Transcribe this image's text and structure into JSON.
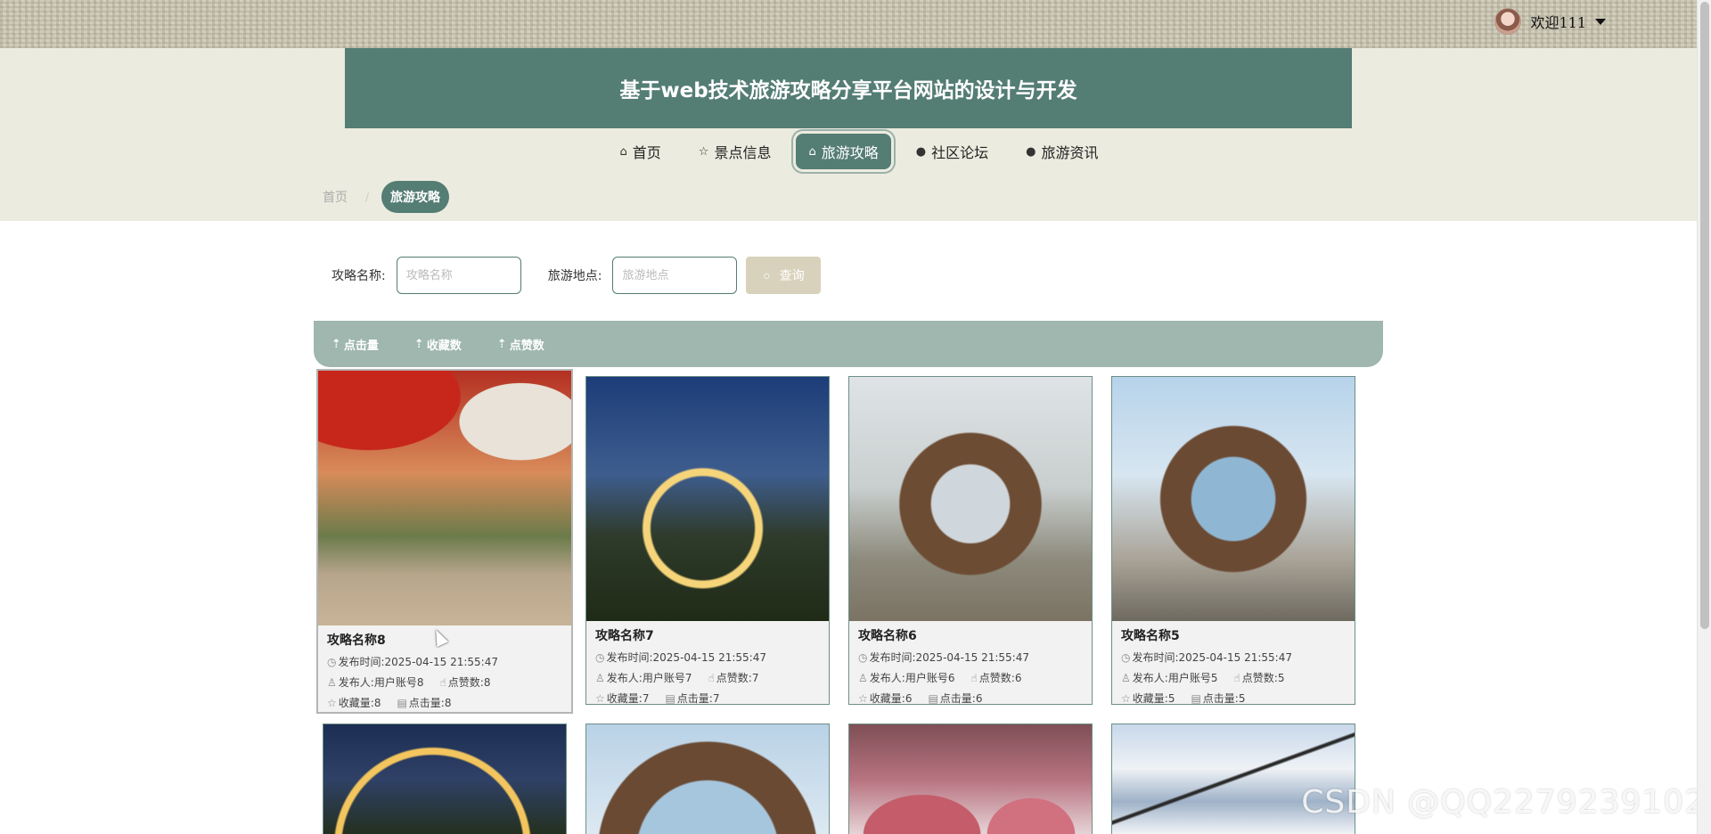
{
  "user": {
    "welcome": "欢迎111"
  },
  "banner": {
    "title": "基于web技术旅游攻略分享平台网站的设计与开发"
  },
  "nav": [
    {
      "icon": "⌂",
      "label": "首页"
    },
    {
      "icon": "☆",
      "label": "景点信息"
    },
    {
      "icon": "⌂",
      "label": "旅游攻略"
    },
    {
      "icon": "●",
      "label": "社区论坛"
    },
    {
      "icon": "●",
      "label": "旅游资讯"
    }
  ],
  "breadcrumb": {
    "home": "首页",
    "current": "旅游攻略"
  },
  "search": {
    "name_label": "攻略名称:",
    "name_placeholder": "攻略名称",
    "place_label": "旅游地点:",
    "place_placeholder": "旅游地点",
    "button": "查询"
  },
  "sort": [
    "点击量",
    "收藏数",
    "点赞数"
  ],
  "cards": [
    {
      "title": "攻略名称8",
      "time_label": "发布时间:",
      "time": "2025-04-15 21:55:47",
      "author_label": "发布人:",
      "author": "用户账号8",
      "likes_label": "点赞数:",
      "likes": "8",
      "fav_label": "收藏量:",
      "fav": "8",
      "click_label": "点击量:",
      "clicks": "8"
    },
    {
      "title": "攻略名称7",
      "time_label": "发布时间:",
      "time": "2025-04-15 21:55:47",
      "author_label": "发布人:",
      "author": "用户账号7",
      "likes_label": "点赞数:",
      "likes": "7",
      "fav_label": "收藏量:",
      "fav": "7",
      "click_label": "点击量:",
      "clicks": "7"
    },
    {
      "title": "攻略名称6",
      "time_label": "发布时间:",
      "time": "2025-04-15 21:55:47",
      "author_label": "发布人:",
      "author": "用户账号6",
      "likes_label": "点赞数:",
      "likes": "6",
      "fav_label": "收藏量:",
      "fav": "6",
      "click_label": "点击量:",
      "clicks": "6"
    },
    {
      "title": "攻略名称5",
      "time_label": "发布时间:",
      "time": "2025-04-15 21:55:47",
      "author_label": "发布人:",
      "author": "用户账号5",
      "likes_label": "点赞数:",
      "likes": "5",
      "fav_label": "收藏量:",
      "fav": "5",
      "click_label": "点击量:",
      "clicks": "5"
    }
  ],
  "watermark": "CSDN @QQ2279239102"
}
